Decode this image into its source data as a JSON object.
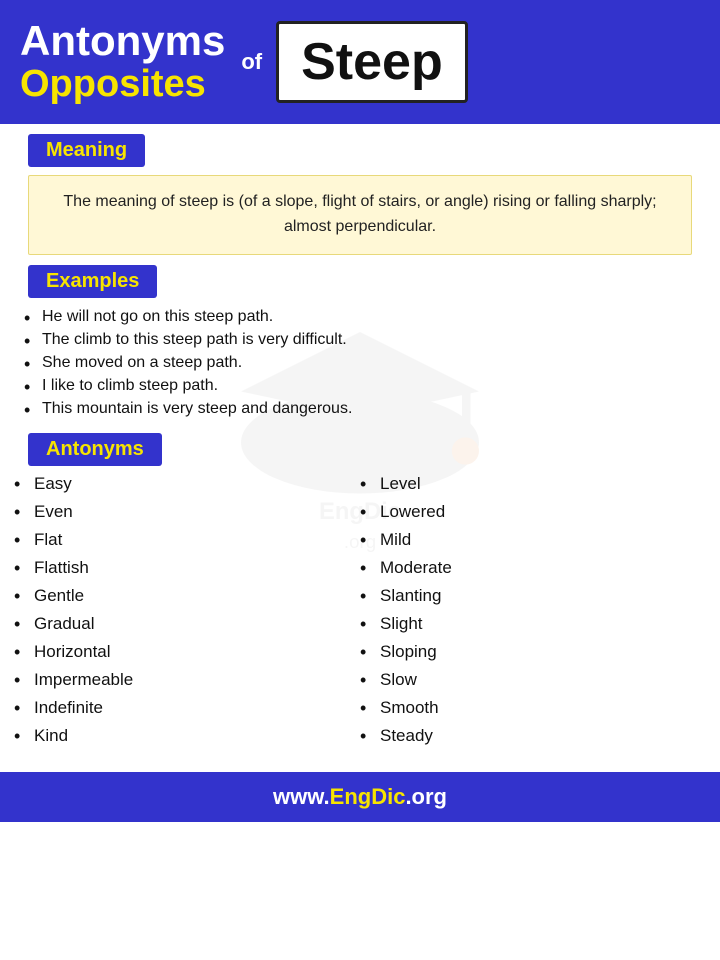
{
  "header": {
    "line1": "Antonyms",
    "line2": "Opposites",
    "of_label": "of",
    "word": "Steep"
  },
  "meaning": {
    "section_label": "Meaning",
    "text": "The meaning of steep is (of a slope, flight of stairs, or angle) rising or falling sharply; almost perpendicular."
  },
  "examples": {
    "section_label": "Examples",
    "items": [
      "He will not go on this steep path.",
      "The climb to this steep path is very difficult.",
      "She moved on a steep path.",
      "I like to climb steep path.",
      "This mountain is very steep and dangerous."
    ]
  },
  "antonyms": {
    "section_label": "Antonyms",
    "col1": [
      "Easy",
      "Even",
      "Flat",
      "Flattish",
      "Gentle",
      "Gradual",
      "Horizontal",
      "Impermeable",
      "Indefinite",
      "Kind"
    ],
    "col2": [
      "Level",
      "Lowered",
      "Mild",
      "Moderate",
      "Slanting",
      "Slight",
      "Sloping",
      "Slow",
      "Smooth",
      "Steady"
    ]
  },
  "footer": {
    "url_prefix": "www.",
    "url_brand": "EngDic",
    "url_suffix": ".org"
  }
}
